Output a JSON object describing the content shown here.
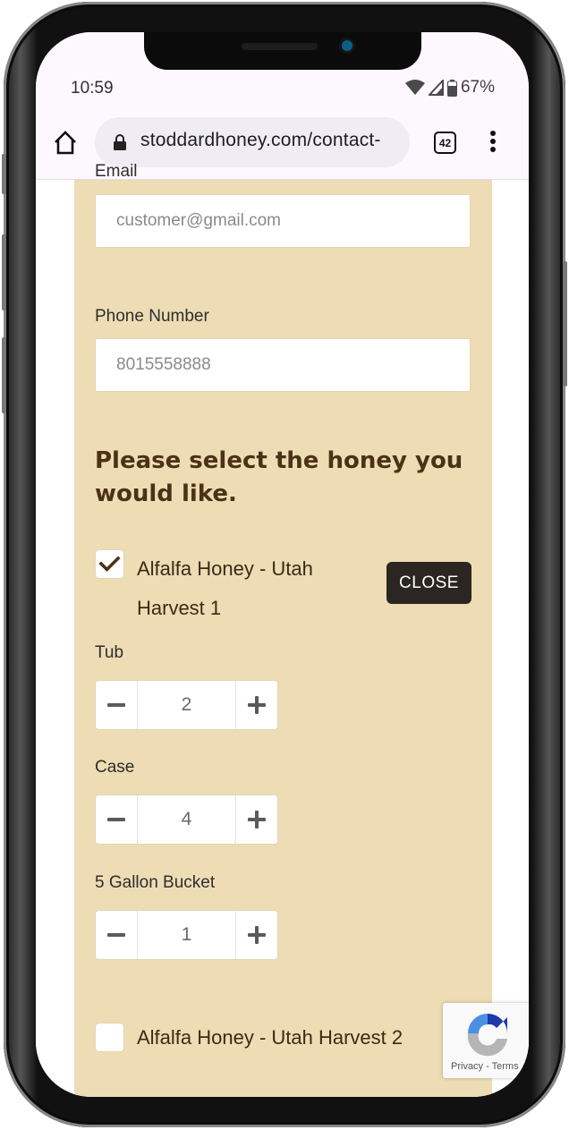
{
  "status_bar": {
    "time": "10:59",
    "battery": "67%",
    "icons": [
      "wifi-icon",
      "signal-icon",
      "battery-icon"
    ]
  },
  "browser": {
    "url": "stoddardhoney.com/contact-",
    "tab_count": "42",
    "icons": [
      "home-icon",
      "lock-icon",
      "tabs-icon",
      "more-vert-icon"
    ]
  },
  "form": {
    "email": {
      "label": "Email",
      "placeholder": "customer@gmail.com"
    },
    "phone": {
      "label": "Phone Number",
      "placeholder": "8015558888"
    },
    "heading": "Please select the honey you would like.",
    "close_label": "CLOSE",
    "products": [
      {
        "name_line1": "Alfalfa Honey - Utah",
        "name_line2": "Harvest 1",
        "checked": true,
        "options": [
          {
            "label": "Tub",
            "quantity": "2"
          },
          {
            "label": "Case",
            "quantity": "4"
          },
          {
            "label": "5 Gallon Bucket",
            "quantity": "1"
          }
        ]
      },
      {
        "name": "Alfalfa Honey - Utah Harvest 2",
        "checked": false
      }
    ]
  },
  "recaptcha": {
    "privacy": "Privacy",
    "separator": "-",
    "terms": "Terms"
  },
  "colors": {
    "panel_bg": "#eddcb4",
    "heading": "#4b3217",
    "close_button": "#2b2622",
    "checkmark": "#4b3217"
  }
}
